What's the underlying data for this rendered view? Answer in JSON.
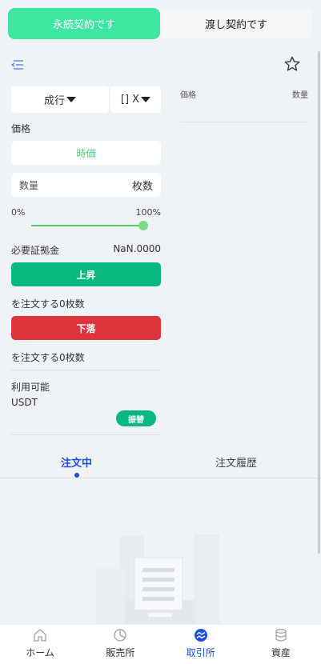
{
  "contract_tabs": [
    "永続契約です",
    "渡し契約です"
  ],
  "form": {
    "order_type": "成行",
    "leverage": "[] X",
    "price_label": "価格",
    "price_value": "時価",
    "qty_placeholder": "数量",
    "qty_unit": "枚数",
    "pct_min": "0%",
    "pct_max": "100%",
    "slider_value": 1.0,
    "margin_label": "必要証拠金",
    "margin_value": "NaN.0000",
    "buy_label": "上昇",
    "buy_order_text": "を注文する0枚数",
    "sell_label": "下落",
    "sell_order_text": "を注文する0枚数",
    "available_label": "利用可能",
    "available_coin": "USDT",
    "transfer_label": "振替"
  },
  "order_book": {
    "price_header": "価格",
    "qty_header": "数量"
  },
  "order_tabs": [
    "注文中",
    "注文履歴"
  ],
  "bottom_nav": [
    {
      "label": "ホーム",
      "icon": "home-icon"
    },
    {
      "label": "販売所",
      "icon": "chart-pie-icon"
    },
    {
      "label": "取引所",
      "icon": "exchange-icon"
    },
    {
      "label": "資産",
      "icon": "database-icon"
    }
  ],
  "colors": {
    "accent_green": "#3ee6a0",
    "buy": "#07b97f",
    "sell": "#e0343d",
    "active_blue": "#1b4de0"
  }
}
